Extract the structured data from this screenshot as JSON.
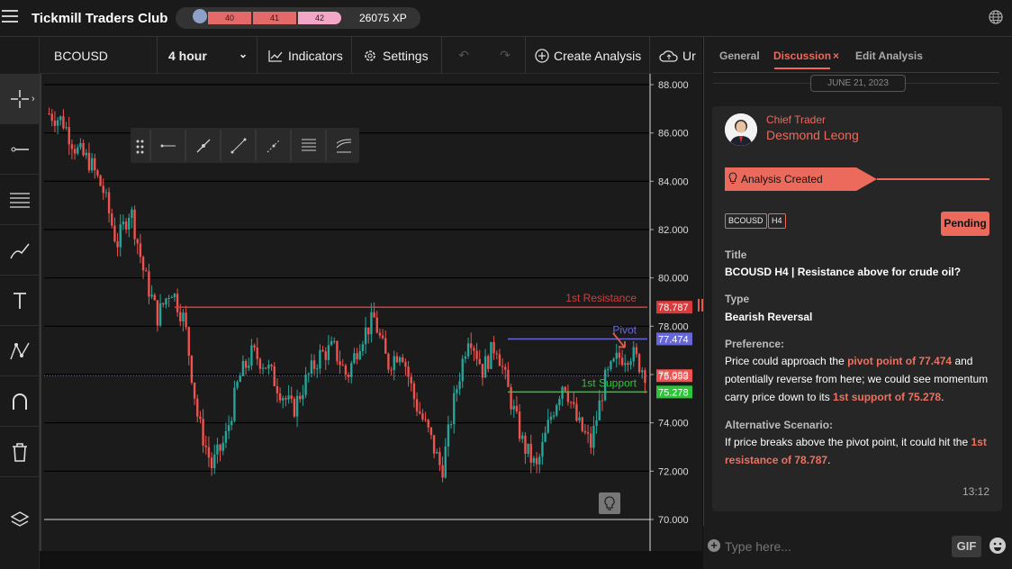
{
  "app": {
    "brand": "Tickmill Traders Club",
    "xp": "26075 XP",
    "levels": [
      "40",
      "41",
      "42"
    ]
  },
  "toolbar": {
    "symbol": "BCOUSD",
    "timeframe": "4 hour",
    "indicators": "Indicators",
    "settings": "Settings",
    "create": "Create Analysis",
    "extra": "Ur"
  },
  "chart": {
    "price_ticks": [
      "88.000",
      "86.000",
      "84.000",
      "82.000",
      "80.000",
      "78.000",
      "76.000",
      "74.000",
      "72.000",
      "70.000"
    ],
    "resistance": {
      "label": "1st Resistance",
      "value": "78.787"
    },
    "pivot": {
      "label": "Pivot",
      "value": "77.474"
    },
    "support": {
      "label": "1st Support",
      "value": "75.278"
    },
    "current": {
      "value": "75.953"
    }
  },
  "chart_data": {
    "type": "line",
    "title": "",
    "ylim": [
      70,
      88
    ],
    "series": [
      {
        "values": [
          86.8,
          86.5,
          85.3,
          84.8,
          83.6,
          81.4,
          82.9,
          80.2,
          78.4,
          79.6,
          78.2,
          74.1,
          72.2,
          73.3,
          75.8,
          76.9,
          76.4,
          75.4,
          74.5,
          75.8,
          76.8,
          77.1,
          75.9,
          77.5,
          78.3,
          76.4,
          77.1,
          74.9,
          73.6,
          72.0,
          75.2,
          77.8,
          76.2,
          77.3,
          75.1,
          73.1,
          72.1,
          74.2,
          75.8,
          74.0,
          73.1,
          75.7,
          76.7,
          76.9,
          76.1
        ]
      },
      {
        "name": "1st Resistance",
        "values": [
          78.787
        ]
      },
      {
        "name": "Pivot",
        "values": [
          77.474
        ]
      },
      {
        "name": "1st Support",
        "values": [
          75.278
        ]
      }
    ]
  },
  "panel": {
    "tabs": [
      "General",
      "Discussion",
      "Edit Analysis"
    ],
    "date": "JUNE 21, 2023",
    "role": "Chief Trader",
    "author": "Desmond Leong",
    "banner": "Analysis Created",
    "tags": [
      "BCOUSD",
      "H4"
    ],
    "status": "Pending",
    "title_label": "Title",
    "title": "BCOUSD H4 | Resistance above for crude oil?",
    "type_label": "Type",
    "type": "Bearish Reversal",
    "pref_label": "Preference:",
    "pref1": "Price could approach the ",
    "pref_hl1": "pivot point of 77.474",
    "pref2": " and potentially reverse from here; we could see momentum carry price down to its ",
    "pref_hl2": "1st support of 75.278",
    "pref3": ".",
    "alt_label": "Alternative Scenario:",
    "alt1": "If price breaks above the pivot point, it could hit the ",
    "alt_hl": "1st resistance of 78.787",
    "alt2": ".",
    "time": "13:12",
    "input_placeholder": "Type here...",
    "gif": "GIF"
  },
  "colors": {
    "accent": "#ec6a5c",
    "resistance": "#d83b3b",
    "pivot": "#6767d8",
    "support": "#2ec43a",
    "bull": "#26a69a",
    "bear": "#ef5350"
  }
}
